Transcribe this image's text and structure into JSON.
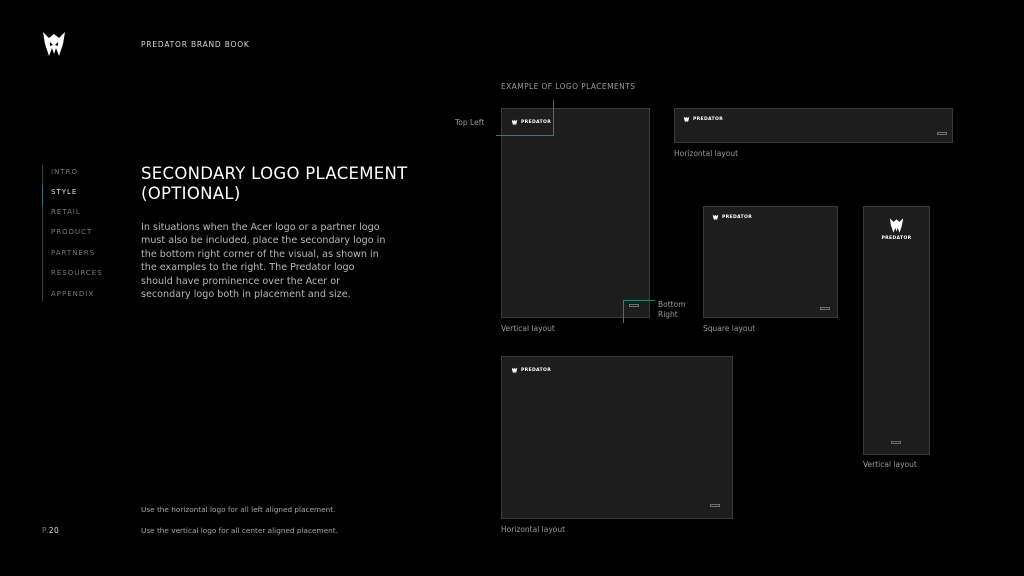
{
  "header": {
    "brand_title": "PREDATOR BRAND BOOK"
  },
  "nav": {
    "items": [
      {
        "label": "INTRO"
      },
      {
        "label": "STYLE",
        "active": true
      },
      {
        "label": "RETAIL"
      },
      {
        "label": "PRODUCT"
      },
      {
        "label": "PARTNERS"
      },
      {
        "label": "RESOURCES"
      },
      {
        "label": "APPENDIX"
      }
    ]
  },
  "content": {
    "heading_line1": "SECONDARY LOGO PLACEMENT",
    "heading_line2": "(OPTIONAL)",
    "body": "In situations when the Acer logo or a partner logo must also be included, place the secondary logo in the bottom right corner of the visual, as shown in the examples to the right. The Predator logo should have prominence over the Acer or secondary logo both in placement and size.",
    "note_1": "Use the horizontal logo for all left aligned placement.",
    "note_2": "Use the vertical logo for all center aligned placement."
  },
  "footer": {
    "page_prefix": "P.",
    "page_number": "20"
  },
  "examples": {
    "section_label": "EXAMPLE OF LOGO PLACEMENTS",
    "wordmark": "PREDATOR",
    "callout_top_left": "Top Left",
    "callout_bottom": "Bottom",
    "callout_right": "Right",
    "captions": {
      "vertical_tall": "Vertical layout",
      "horizontal_wide": "Horizontal layout",
      "square": "Square layout",
      "vertical_narrow": "Vertical layout",
      "horizontal_large": "Horizontal layout"
    }
  },
  "icons": {
    "brand_logo": "predator-claw-icon",
    "secondary_logo": "secondary-logo-badge"
  },
  "colors": {
    "background": "#000000",
    "frame": "#1d1d1d",
    "accent_line": "#3d7384"
  }
}
